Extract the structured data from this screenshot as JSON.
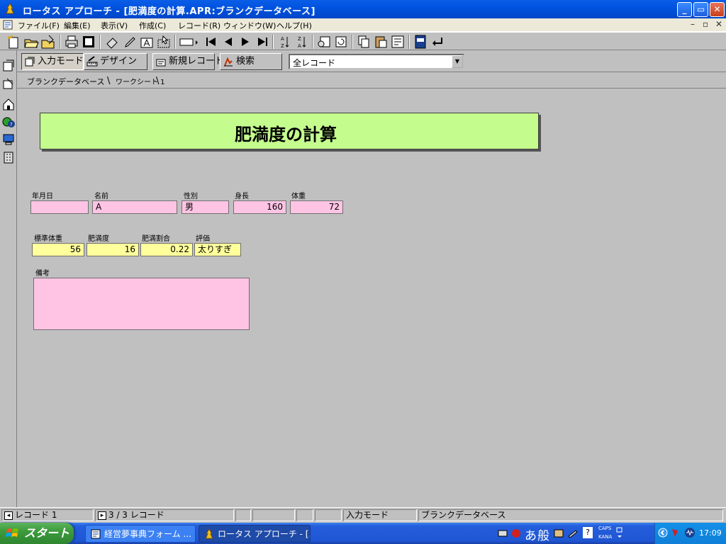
{
  "window": {
    "title": "ロータス アプローチ - [肥満度の計算.APR:ブランクデータベース]",
    "controls": {
      "minimize": "_",
      "maximize": "▭",
      "close": "✕"
    }
  },
  "menu": {
    "items": [
      "ファイル(F)",
      "編集(E)",
      "表示(V)",
      "作成(C)",
      "レコード(R)",
      "ウィンドウ(W)",
      "ヘルプ(H)"
    ],
    "mdi": {
      "minimize": "–",
      "restore": "▫",
      "close": "✕"
    }
  },
  "toolbar": {
    "icons": [
      "new-sparkle-icon",
      "open-folder-icon",
      "open-folder-edit-icon",
      "print-icon",
      "preview-icon",
      "eraser-icon",
      "pen-icon",
      "text-tool-icon",
      "select-tool-icon",
      "field-box-icon",
      "first-record-icon",
      "prev-record-icon",
      "next-record-icon",
      "last-record-icon",
      "sort-asc-icon",
      "sort-desc-icon",
      "find-icon",
      "refresh-icon",
      "copy-icon",
      "paste-icon",
      "report-icon",
      "spellcheck-icon",
      "enter-icon"
    ]
  },
  "modebar": {
    "browse": "入力モード",
    "design": "デザイン",
    "new_record": "新規レコード",
    "find": "検索",
    "record_filter": "全レコード",
    "record_filter_arrow": "▼"
  },
  "tabs": [
    {
      "label": "ブランクデータベース",
      "active": true
    },
    {
      "label": "ワークシート 1",
      "active": false
    }
  ],
  "form": {
    "title": "肥満度の計算",
    "row1": [
      {
        "label": "年月日",
        "value": ""
      },
      {
        "label": "名前",
        "value": "A"
      },
      {
        "label": "性別",
        "value": "男"
      },
      {
        "label": "身長",
        "value": "160"
      },
      {
        "label": "体重",
        "value": "72"
      }
    ],
    "row2": [
      {
        "label": "標準体重",
        "value": "56"
      },
      {
        "label": "肥満度",
        "value": "16"
      },
      {
        "label": "肥満割合",
        "value": "0.22"
      },
      {
        "label": "評価",
        "value": "太りすぎ"
      }
    ],
    "notes": {
      "label": "備考",
      "value": ""
    }
  },
  "status": {
    "record": "レコード 1",
    "count": "3 / 3 レコード",
    "mode": "入力モード",
    "view": "ブランクデータベース"
  },
  "taskbar": {
    "start": "スタート",
    "tasks": [
      {
        "label": "経営夢事典フォーム ...",
        "active": false
      },
      {
        "label": "ロータス アプローチ - [...",
        "active": true
      }
    ],
    "ime": {
      "mode": "あ",
      "kanji": "般",
      "caps": "CAPS",
      "kana": "KANA"
    },
    "clock": "17:09"
  },
  "colors": {
    "title_banner": "#c4fc8e",
    "field_pink": "#ffc4e4",
    "field_yellow": "#ffff9c",
    "titlebar": "#0053e0",
    "workspace": "#c0c0c0"
  }
}
